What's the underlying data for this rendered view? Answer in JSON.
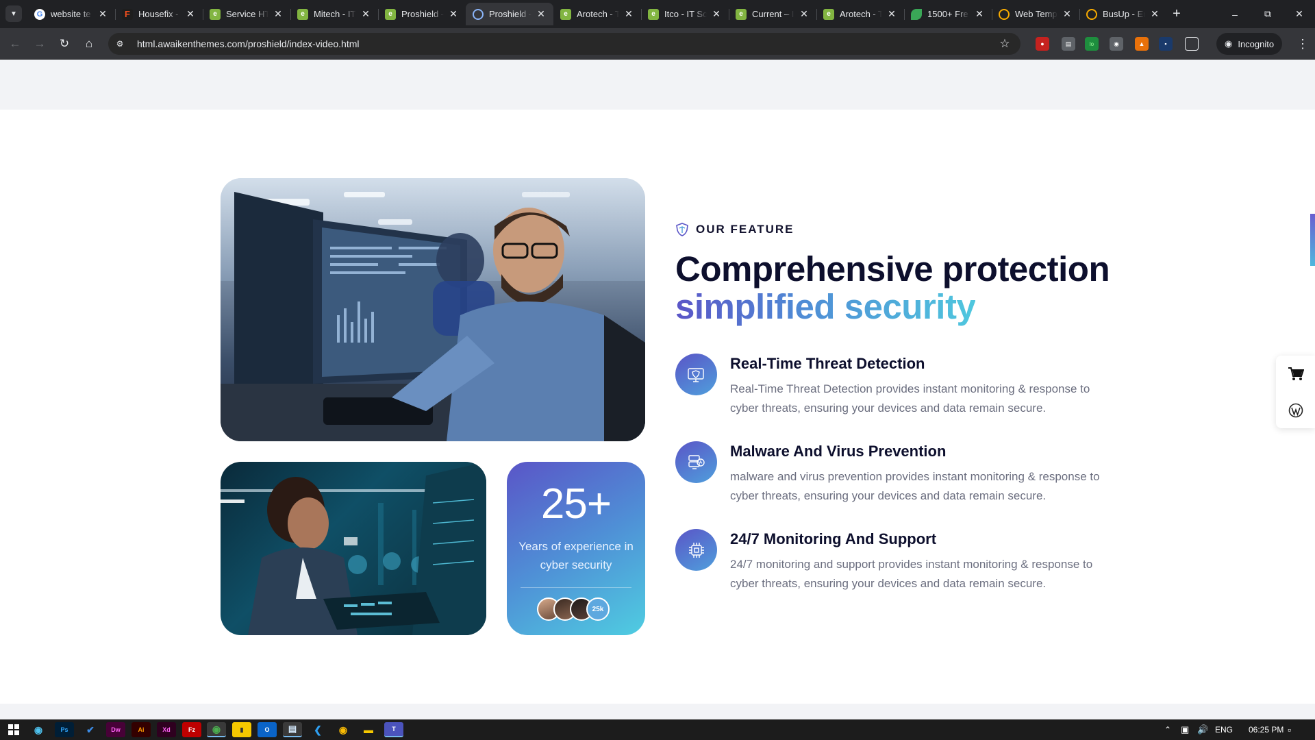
{
  "browser": {
    "tabs": [
      {
        "title": "website te",
        "favicon": "google-icon",
        "active": false
      },
      {
        "title": "Housefix -",
        "favicon": "figma-icon",
        "active": false
      },
      {
        "title": "Service HT",
        "favicon": "envato-icon",
        "active": false
      },
      {
        "title": "Mitech - IT",
        "favicon": "envato-icon",
        "active": false
      },
      {
        "title": "Proshield -",
        "favicon": "envato-icon",
        "active": false
      },
      {
        "title": "Proshield -",
        "favicon": "globe-icon",
        "active": true
      },
      {
        "title": "Arotech - T",
        "favicon": "envato-icon",
        "active": false
      },
      {
        "title": "Itco - IT So",
        "favicon": "envato-icon",
        "active": false
      },
      {
        "title": "Current – I",
        "favicon": "envato-icon",
        "active": false
      },
      {
        "title": "Arotech - T",
        "favicon": "envato-icon",
        "active": false
      },
      {
        "title": "1500+ Fre",
        "favicon": "leaf-icon",
        "active": false
      },
      {
        "title": "Web Temp",
        "favicon": "webtemplate-icon",
        "active": false
      },
      {
        "title": "BusUp - Er",
        "favicon": "webtemplate-icon",
        "active": false
      }
    ],
    "url": "html.awaikenthemes.com/proshield/index-video.html",
    "incognito_label": "Incognito"
  },
  "page": {
    "eyebrow": "OUR FEATURE",
    "heading_line1": "Comprehensive protection",
    "heading_line2": "simplified security",
    "stat": {
      "number": "25+",
      "label": "Years of experience in cyber security",
      "avatar_count": "25k"
    },
    "features": [
      {
        "icon": "monitor-shield-icon",
        "title": "Real-Time Threat Detection",
        "description": "Real-Time Threat Detection provides instant monitoring & response to cyber threats, ensuring your devices and data remain secure."
      },
      {
        "icon": "server-bug-icon",
        "title": "Malware And Virus Prevention",
        "description": "malware and virus prevention provides instant monitoring & response to cyber threats, ensuring your devices and data remain secure."
      },
      {
        "icon": "chip-icon",
        "title": "24/7 Monitoring And Support",
        "description": "24/7 monitoring and support provides instant monitoring & response to cyber threats, ensuring your devices and data remain secure."
      }
    ],
    "colors": {
      "heading": "#0d0f2d",
      "gradient_start": "#5a55c7",
      "gradient_end": "#4fcde1",
      "body_text": "#6b6e7f"
    }
  },
  "taskbar": {
    "language": "ENG",
    "time": "06:25 PM"
  }
}
